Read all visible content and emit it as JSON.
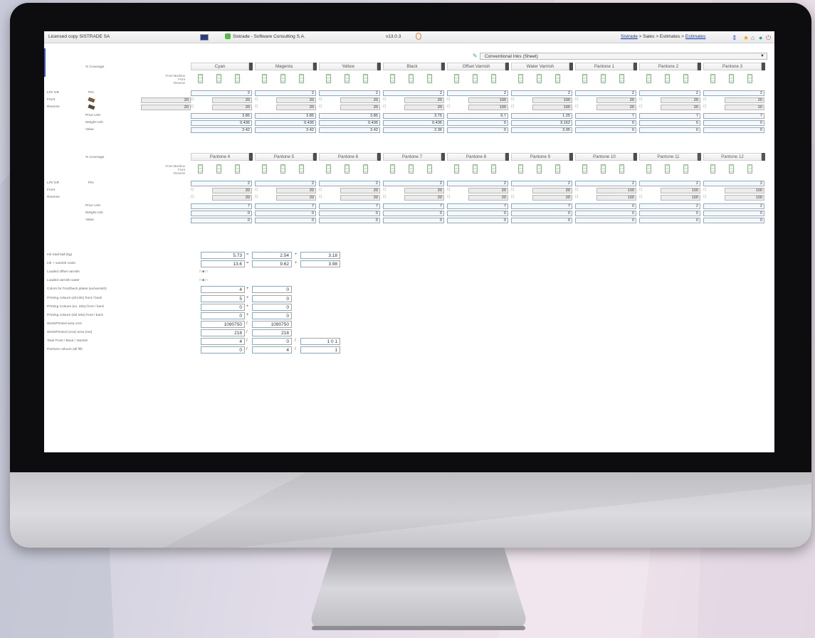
{
  "app": {
    "license": "Licensed copy SISTRADE SA",
    "title": "Sistrade - Software Consulting S.A.",
    "version": "v13.0.3",
    "breadcrumb": {
      "first": "Sistrade",
      "middle": " > Sales > Estimates > ",
      "last": "Estimates"
    }
  },
  "inks_select": {
    "value": "Conventional Inks (Sheet)"
  },
  "labels": {
    "coverage": "% Coverage",
    "icon_rows": "Front Machine\nFront\nReverse",
    "lpi": "LPI/ GR",
    "lpi_val": "PKI",
    "front": "Front",
    "reverse": "Reverse",
    "price": "Price Unit",
    "weight": "Weight Unit",
    "value": "Value"
  },
  "inks_row1": [
    {
      "name": "Cyan",
      "qty": "2",
      "front": "20",
      "reverse": "20",
      "price": "3.85",
      "weight": "0.436",
      "value": "2.42"
    },
    {
      "name": "Magenta",
      "qty": "2",
      "front": "20",
      "reverse": "20",
      "price": "3.85",
      "weight": "0.436",
      "value": "2.42"
    },
    {
      "name": "Yellow",
      "qty": "2",
      "front": "20",
      "reverse": "20",
      "price": "3.85",
      "weight": "0.436",
      "value": "2.42"
    },
    {
      "name": "Black",
      "qty": "2",
      "front": "20",
      "reverse": "20",
      "price": "3.75",
      "weight": "0.436",
      "value": "2.36"
    },
    {
      "name": "Offset Varnish",
      "qty": "2",
      "front": "100",
      "reverse": "100",
      "price": "6.7",
      "weight": "0",
      "value": "0"
    },
    {
      "name": "Water Varnish",
      "qty": "2",
      "front": "100",
      "reverse": "100",
      "price": "1.25",
      "weight": "3.162",
      "value": "3.95"
    },
    {
      "name": "Pantone 1",
      "qty": "2",
      "front": "20",
      "reverse": "20",
      "price": "7",
      "weight": "0",
      "value": "0"
    },
    {
      "name": "Pantone 2",
      "qty": "2",
      "front": "20",
      "reverse": "20",
      "price": "7",
      "weight": "0",
      "value": "0"
    },
    {
      "name": "Pantone 3",
      "qty": "2",
      "front": "20",
      "reverse": "20",
      "price": "7",
      "weight": "0",
      "value": "0"
    }
  ],
  "inks_row2": [
    {
      "name": "Pantone 4",
      "qty": "2",
      "front": "20",
      "reverse": "20",
      "price": "7",
      "weight": "0",
      "value": "0"
    },
    {
      "name": "Pantone 5",
      "qty": "2",
      "front": "20",
      "reverse": "20",
      "price": "7",
      "weight": "0",
      "value": "0"
    },
    {
      "name": "Pantone 6",
      "qty": "2",
      "front": "20",
      "reverse": "20",
      "price": "7",
      "weight": "0",
      "value": "0"
    },
    {
      "name": "Pantone 7",
      "qty": "2",
      "front": "20",
      "reverse": "20",
      "price": "7",
      "weight": "0",
      "value": "0"
    },
    {
      "name": "Pantone 8",
      "qty": "2",
      "front": "20",
      "reverse": "20",
      "price": "7",
      "weight": "0",
      "value": "0"
    },
    {
      "name": "Pantone 9",
      "qty": "2",
      "front": "20",
      "reverse": "20",
      "price": "7",
      "weight": "0",
      "value": "0"
    },
    {
      "name": "Pantone 10",
      "qty": "2",
      "front": "100",
      "reverse": "100",
      "price": "0",
      "weight": "0",
      "value": "0"
    },
    {
      "name": "Pantone 11",
      "qty": "2",
      "front": "100",
      "reverse": "100",
      "price": "2",
      "weight": "0",
      "value": "0"
    },
    {
      "name": "Pantone 12",
      "qty": "2",
      "front": "100",
      "reverse": "100",
      "price": "2",
      "weight": "0",
      "value": "0"
    }
  ],
  "left_front": "20",
  "left_reverse": "20",
  "summary": [
    {
      "label": "Ink total ball (kg)",
      "a": "5.73",
      "op1": "=",
      "b": "2.54",
      "op2": "+",
      "c": "3.18"
    },
    {
      "label": "Ink + varnish costs",
      "a": "13.6",
      "op1": "=",
      "b": "9.62",
      "op2": "+",
      "c": "3.98"
    },
    {
      "label": "Loaded offset varnish",
      "a": "",
      "op1": "",
      "b": "",
      "op2": "",
      "c": ""
    },
    {
      "label": "Loaded varnish water",
      "a": "",
      "op1": "",
      "b": "",
      "op2": "",
      "c": ""
    },
    {
      "label": "Colors for front/back plates (ex/varnish)",
      "a": "4",
      "op1": "+",
      "b": "0",
      "op2": "",
      "c": ""
    },
    {
      "label": "Printing colours (all inks) front / back",
      "a": "5",
      "op1": "+",
      "b": "0",
      "op2": "",
      "c": ""
    },
    {
      "label": "Printing Colours (ex. inks) front / back",
      "a": "0",
      "op1": "+",
      "b": "0",
      "op2": "",
      "c": ""
    },
    {
      "label": "Printing colours (std inks) front / back",
      "a": "0",
      "op1": "+",
      "b": "0",
      "op2": "",
      "c": ""
    },
    {
      "label": "Work/Printed area cm2",
      "a": "1090750",
      "op1": "/",
      "b": "1090750",
      "op2": "",
      "c": ""
    },
    {
      "label": "Work/Printed (cm2) area (m2)",
      "a": "218",
      "op1": "/",
      "b": "218",
      "op2": "",
      "c": ""
    },
    {
      "label": "Total Front / Back / Varnish",
      "a": "4",
      "op1": "/",
      "b": "0",
      "op2": "/",
      "c": "1 0 1"
    },
    {
      "label": "Pantone colours (all fill)",
      "a": "0",
      "op1": "/",
      "b": "4",
      "op2": "/",
      "c": "1"
    }
  ],
  "checks": {
    "offset": "□ ■ □",
    "water": "□ ■ □"
  }
}
